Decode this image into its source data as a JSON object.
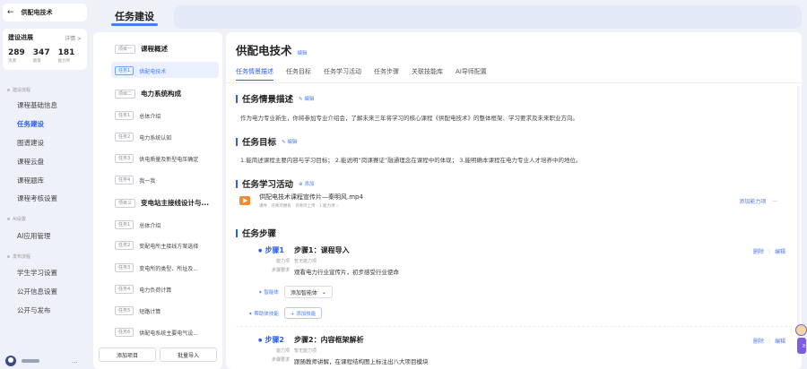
{
  "sidebar": {
    "back_icon": "arrow-left-icon",
    "course_name": "供配电技术",
    "progress": {
      "title": "建设进展",
      "link": "详情 >",
      "stats": [
        {
          "value": "289",
          "label": "资源"
        },
        {
          "value": "347",
          "label": "题目"
        },
        {
          "value": "181",
          "label": "能力项"
        }
      ]
    },
    "sections": [
      {
        "label": "建设流程",
        "items": [
          "课程基础信息",
          "任务建设",
          "图谱建设",
          "课程云盘",
          "课程题库",
          "课程考核设置"
        ]
      },
      {
        "label": "AI设置",
        "items": [
          "AI应用管理"
        ]
      },
      {
        "label": "发布流程",
        "items": [
          "学生学习设置",
          "公开信息设置",
          "公开与发布"
        ]
      }
    ],
    "active_item": "任务建设",
    "user_more": "..."
  },
  "top_tab": {
    "label": "任务建设"
  },
  "tasklist": {
    "projects": [
      {
        "tag": "项目一",
        "title": "课程概述"
      },
      {
        "tag": "项目二",
        "title": "电力系统构成"
      },
      {
        "tag": "项目三",
        "title": "变电站主接线设计与..."
      }
    ],
    "tasks": [
      {
        "tag": "任务1",
        "title": "供配电技术"
      },
      {
        "tag": "任务1",
        "title": "总体介绍"
      },
      {
        "tag": "任务2",
        "title": "电力系统认知"
      },
      {
        "tag": "任务3",
        "title": "供电质量及新型电压确定"
      },
      {
        "tag": "任务4",
        "title": "我一我"
      },
      {
        "tag": "任务1",
        "title": "总体介绍"
      },
      {
        "tag": "任务2",
        "title": "变配电所主接线方案选择"
      },
      {
        "tag": "任务3",
        "title": "变电所的类型、所址及..."
      },
      {
        "tag": "任务4",
        "title": "电力负荷计算"
      },
      {
        "tag": "任务5",
        "title": "短路计算"
      },
      {
        "tag": "任务6",
        "title": "供配电系统主要电气设..."
      }
    ],
    "add_project": "添加项目",
    "batch_import": "批量导入"
  },
  "main": {
    "title": "供配电技术",
    "title_edit": "编辑",
    "tabs": [
      "任务情景描述",
      "任务目标",
      "任务学习活动",
      "任务步骤",
      "关联技能库",
      "AI导师配置"
    ],
    "active_tab": "任务情景描述",
    "scenario": {
      "title": "任务情景描述",
      "action": "编辑",
      "text": "作为电力专业新生，你将参加专业介绍会，了解未来三年将学习的核心课程《供配电技术》的整体框架、学习要求及未来职业方向。"
    },
    "goals": {
      "title": "任务目标",
      "action": "编辑",
      "text": "1.能简述课程主要内容与学习目标； 2.能说明“岗课赛证”融通理念在课程中的体现； 3.能明确本课程在电力专业人才培养中的地位。"
    },
    "activity": {
      "title": "任务学习活动",
      "action": "添加",
      "video_name": "供配电技术课程宣传片—秦明风.mp4",
      "video_meta": "课件 · 许青玲拥有 · 许青玲上传 · 1 能力项 ›",
      "add_capability": "添加能力项",
      "more": "···"
    },
    "steps": {
      "title": "任务步骤",
      "items": [
        {
          "no": "步骤1",
          "name": "步骤1：课程导入",
          "cap_key": "能力项",
          "cap_val": "暂无能力项",
          "req_key": "步骤要求",
          "req_val": "观看电力行业宣传片，初步感受行业使命",
          "delete": "删除",
          "edit": "编辑"
        },
        {
          "no": "步骤2",
          "name": "步骤2：内容框架解析",
          "cap_key": "能力项",
          "cap_val": "暂无能力项",
          "req_key": "步骤要求",
          "req_val": "跟随教师讲解，在课程结构图上标注出八大项目模块",
          "delete": "删除",
          "edit": "编辑"
        }
      ],
      "agent_label": "智能体",
      "agent_select": "添加智能体",
      "skill_label": "帮助体技能",
      "skill_button": "+ 添加技能"
    }
  },
  "helper_label": "AI"
}
